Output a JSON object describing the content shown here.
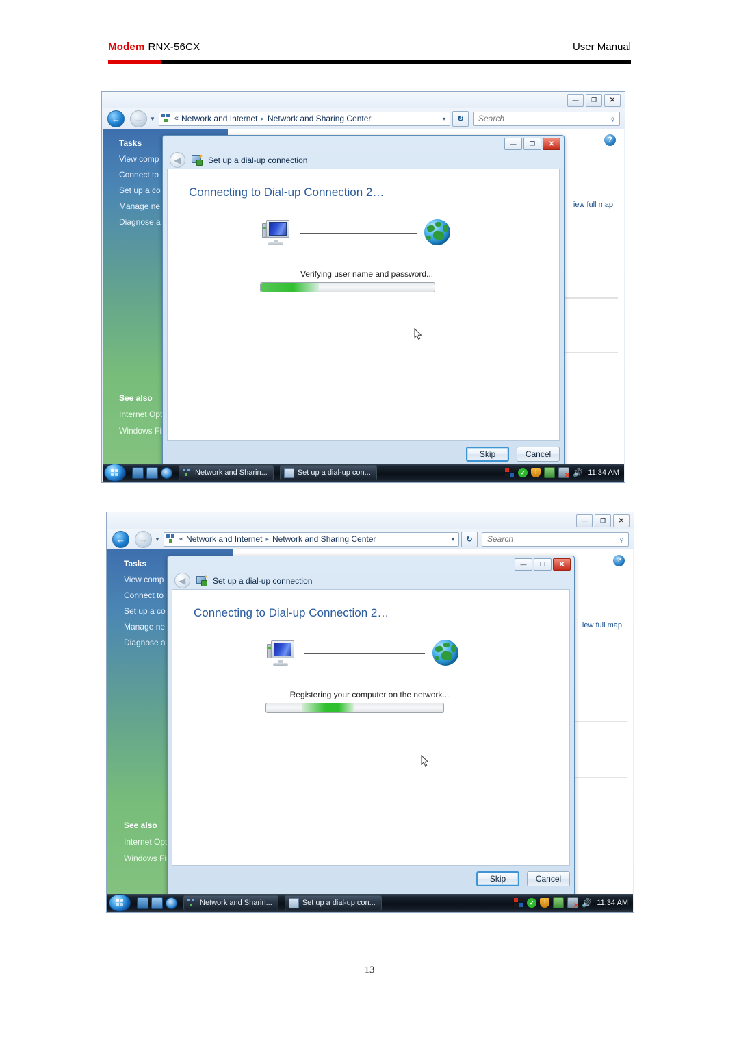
{
  "document": {
    "header": {
      "brand": "Modem",
      "model": "RNX-56CX",
      "right": "User  Manual"
    },
    "page_number": "13"
  },
  "explorer": {
    "address": {
      "chevron": "«",
      "crumb1": "Network and Internet",
      "crumb_arrow": "▸",
      "crumb2": "Network and Sharing Center",
      "dropdown_caret": "▾"
    },
    "refresh_label": "↻",
    "search": {
      "placeholder": "Search",
      "icon": "search-icon"
    },
    "window_buttons": {
      "minimize": "—",
      "maximize": "❐",
      "close": "✕"
    },
    "sidebar": {
      "tasks_heading": "Tasks",
      "items": [
        {
          "label": "View comp"
        },
        {
          "label": "Connect to"
        },
        {
          "label": "Set up a co"
        },
        {
          "label": "Manage ne"
        },
        {
          "label": "Diagnose a"
        }
      ],
      "see_also_heading": "See also",
      "see_also_items": [
        {
          "label": "Internet Options"
        },
        {
          "label": "Windows Firewall"
        }
      ]
    },
    "main": {
      "view_full_map": "iew full map",
      "help_icon": "?"
    }
  },
  "dialog": {
    "titlebar_buttons": {
      "minimize": "—",
      "maximize": "❐",
      "close": "✕"
    },
    "back_arrow": "◀",
    "wizard_title": "Set up a dial-up connection",
    "heading": "Connecting to Dial-up Connection 2…",
    "buttons": {
      "skip": "Skip",
      "cancel": "Cancel"
    }
  },
  "shot1": {
    "dialog": {
      "status_text": "Verifying user name and password...",
      "progress_percent": 33
    }
  },
  "shot2": {
    "dialog": {
      "status_text": "Registering your computer on the network...",
      "progress_percent": 50
    }
  },
  "taskbar": {
    "start_label": "Start",
    "quick_launch": [
      "show-desktop-icon",
      "flip3d-icon",
      "internet-explorer-icon"
    ],
    "tasks": [
      {
        "label": "Network and Sharin...",
        "icon": "network-icon"
      },
      {
        "label": "Set up a dial-up con...",
        "icon": "dialup-icon"
      }
    ],
    "tray_icons": [
      "windows-flag-icon",
      "security-check-icon",
      "shield-warning-icon",
      "network-activity-icon",
      "network-disconnected-icon",
      "volume-icon"
    ],
    "clock": "11:34 AM"
  }
}
